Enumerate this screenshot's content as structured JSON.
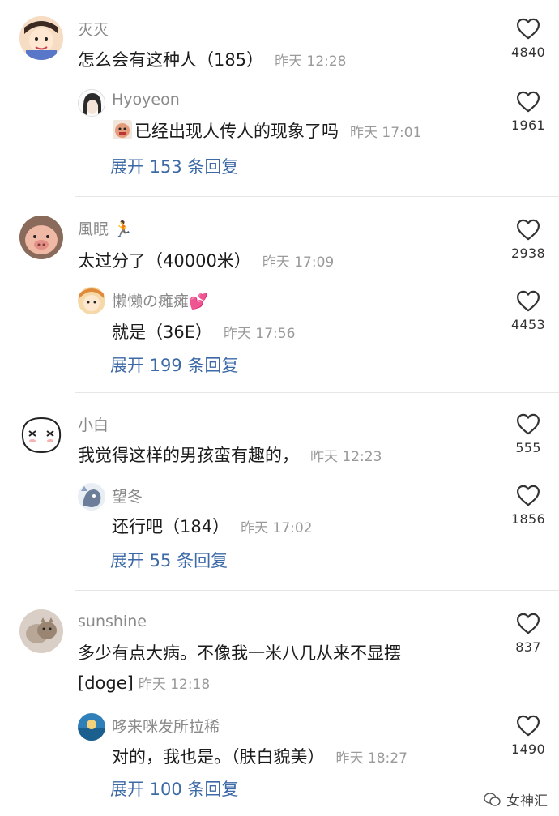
{
  "threads": [
    {
      "comment": {
        "username": "灭灭",
        "text": "怎么会有这种人（185）",
        "time": "昨天 12:28",
        "likes": "4840"
      },
      "reply": {
        "username": "Hyoyeon",
        "text": "已经出现人传人的现象了吗",
        "time": "昨天 17:01",
        "likes": "1961"
      },
      "expand": "展开 153 条回复"
    },
    {
      "comment": {
        "username": "風眠",
        "text": "太过分了（40000米）",
        "time": "昨天 17:09",
        "likes": "2938"
      },
      "reply": {
        "username": "懒懒の瘫瘫",
        "text": "就是（36E）",
        "time": "昨天 17:56",
        "likes": "4453"
      },
      "expand": "展开 199 条回复"
    },
    {
      "comment": {
        "username": "小白",
        "text": "我觉得这样的男孩蛮有趣的，",
        "time": "昨天 12:23",
        "likes": "555"
      },
      "reply": {
        "username": "望冬",
        "text": "还行吧（184）",
        "time": "昨天 17:02",
        "likes": "1856"
      },
      "expand": "展开 55 条回复"
    },
    {
      "comment": {
        "username": "sunshine",
        "text": "多少有点大病。不像我一米八几从来不显摆",
        "text2": "[doge]",
        "time": "昨天 12:18",
        "likes": "837"
      },
      "reply": {
        "username": "哆来咪发所拉稀",
        "text": "对的，我也是。（肤白貌美）",
        "time": "昨天 18:27",
        "likes": "1490"
      },
      "expand": "展开 100 条回复"
    }
  ],
  "watermark": "女神汇",
  "colors": {
    "link": "#3d6aa6",
    "meta": "#9a9a9a",
    "username": "#8a8a8a"
  }
}
